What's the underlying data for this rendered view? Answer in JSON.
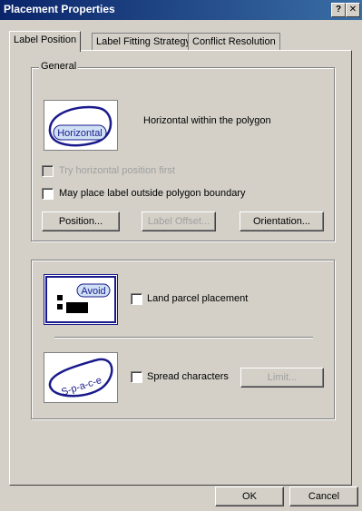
{
  "window": {
    "title": "Placement Properties",
    "help_glyph": "?",
    "close_glyph": "✕"
  },
  "tabs": [
    {
      "label": "Label Position",
      "active": true
    },
    {
      "label": "Label Fitting Strategy",
      "active": false
    },
    {
      "label": "Conflict Resolution",
      "active": false
    }
  ],
  "general": {
    "legend": "General",
    "illustration_word": "Horizontal",
    "description": "Horizontal within the polygon",
    "try_horizontal_label": "Try horizontal position first",
    "may_place_outside_label": "May place label outside polygon boundary",
    "position_button": "Position...",
    "label_offset_button": "Label Offset...",
    "orientation_button": "Orientation..."
  },
  "second_group": {
    "avoid_word": "Avoid",
    "land_parcel_label": "Land parcel placement",
    "spread_word": "S-p-a-c-e",
    "spread_label": "Spread characters",
    "limit_button": "Limit..."
  },
  "footer": {
    "ok_button": "OK",
    "cancel_button": "Cancel"
  },
  "colors": {
    "titlebar_start": "#0a246a",
    "titlebar_end": "#3a6ea5",
    "dialog_face": "#d4d0c8",
    "illustration_outline": "#1a1a8c",
    "illustration_fill": "#cfe0f5"
  }
}
